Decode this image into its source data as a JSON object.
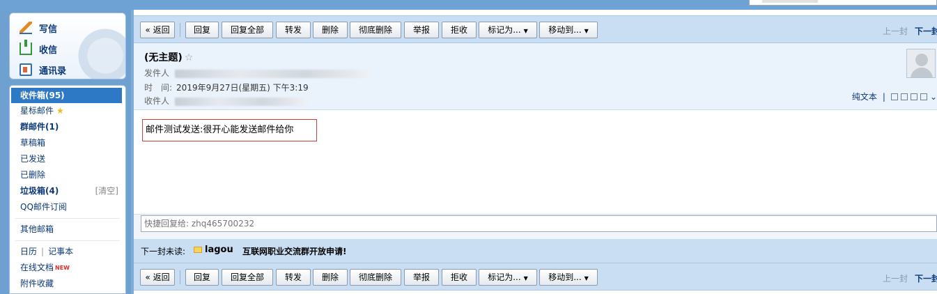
{
  "sidebar": {
    "compose": "写信",
    "receive": "收信",
    "contacts": "通讯录",
    "folders": {
      "inbox": "收件箱(95)",
      "starred": "星标邮件",
      "group": "群邮件(1)",
      "drafts": "草稿箱",
      "sent": "已发送",
      "deleted": "已删除",
      "spam": "垃圾箱(4)",
      "spam_clean": "[清空]",
      "subscription": "QQ邮件订阅",
      "other": "其他邮箱",
      "calendar": "日历",
      "notes": "记事本",
      "docs": "在线文档",
      "docs_badge": "NEW",
      "attachments": "附件收藏"
    }
  },
  "toolbar": {
    "back": "« 返回",
    "reply": "回复",
    "reply_all": "回复全部",
    "forward": "转发",
    "delete": "删除",
    "delete_perm": "彻底删除",
    "report": "举报",
    "reject": "拒收",
    "mark_as": "标记为...",
    "move_to": "移动到...",
    "prev": "上一封",
    "next": "下一封"
  },
  "message": {
    "subject": "(无主题)",
    "from_label": "发件人",
    "time_label": "时　间:",
    "time_value": "2019年9月27日(星期五) 下午3:19",
    "to_label": "收件人",
    "plain_text": "纯文本",
    "body": "邮件测试发送:很开心能发送邮件给你"
  },
  "quick_reply": {
    "placeholder": "快捷回复给: zhq465700232"
  },
  "next_unread": {
    "label": "下一封未读:",
    "sender": "lagou",
    "subject": "互联网职业交流群开放申请!"
  },
  "colors": {
    "accent": "#2e79c6",
    "toolbar_bg": "#c9def3",
    "frame_bg": "#6fa1d0",
    "highlight_border": "#d43c3c"
  }
}
